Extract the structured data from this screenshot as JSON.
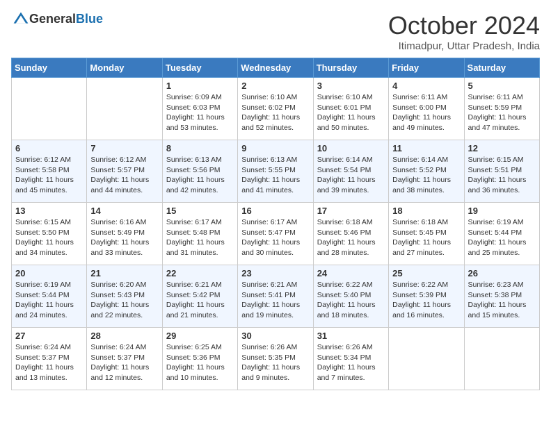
{
  "logo": {
    "general": "General",
    "blue": "Blue"
  },
  "title": "October 2024",
  "location": "Itimadpur, Uttar Pradesh, India",
  "headers": [
    "Sunday",
    "Monday",
    "Tuesday",
    "Wednesday",
    "Thursday",
    "Friday",
    "Saturday"
  ],
  "weeks": [
    [
      {
        "day": null,
        "sunrise": null,
        "sunset": null,
        "daylight": null
      },
      {
        "day": null,
        "sunrise": null,
        "sunset": null,
        "daylight": null
      },
      {
        "day": "1",
        "sunrise": "Sunrise: 6:09 AM",
        "sunset": "Sunset: 6:03 PM",
        "daylight": "Daylight: 11 hours and 53 minutes."
      },
      {
        "day": "2",
        "sunrise": "Sunrise: 6:10 AM",
        "sunset": "Sunset: 6:02 PM",
        "daylight": "Daylight: 11 hours and 52 minutes."
      },
      {
        "day": "3",
        "sunrise": "Sunrise: 6:10 AM",
        "sunset": "Sunset: 6:01 PM",
        "daylight": "Daylight: 11 hours and 50 minutes."
      },
      {
        "day": "4",
        "sunrise": "Sunrise: 6:11 AM",
        "sunset": "Sunset: 6:00 PM",
        "daylight": "Daylight: 11 hours and 49 minutes."
      },
      {
        "day": "5",
        "sunrise": "Sunrise: 6:11 AM",
        "sunset": "Sunset: 5:59 PM",
        "daylight": "Daylight: 11 hours and 47 minutes."
      }
    ],
    [
      {
        "day": "6",
        "sunrise": "Sunrise: 6:12 AM",
        "sunset": "Sunset: 5:58 PM",
        "daylight": "Daylight: 11 hours and 45 minutes."
      },
      {
        "day": "7",
        "sunrise": "Sunrise: 6:12 AM",
        "sunset": "Sunset: 5:57 PM",
        "daylight": "Daylight: 11 hours and 44 minutes."
      },
      {
        "day": "8",
        "sunrise": "Sunrise: 6:13 AM",
        "sunset": "Sunset: 5:56 PM",
        "daylight": "Daylight: 11 hours and 42 minutes."
      },
      {
        "day": "9",
        "sunrise": "Sunrise: 6:13 AM",
        "sunset": "Sunset: 5:55 PM",
        "daylight": "Daylight: 11 hours and 41 minutes."
      },
      {
        "day": "10",
        "sunrise": "Sunrise: 6:14 AM",
        "sunset": "Sunset: 5:54 PM",
        "daylight": "Daylight: 11 hours and 39 minutes."
      },
      {
        "day": "11",
        "sunrise": "Sunrise: 6:14 AM",
        "sunset": "Sunset: 5:52 PM",
        "daylight": "Daylight: 11 hours and 38 minutes."
      },
      {
        "day": "12",
        "sunrise": "Sunrise: 6:15 AM",
        "sunset": "Sunset: 5:51 PM",
        "daylight": "Daylight: 11 hours and 36 minutes."
      }
    ],
    [
      {
        "day": "13",
        "sunrise": "Sunrise: 6:15 AM",
        "sunset": "Sunset: 5:50 PM",
        "daylight": "Daylight: 11 hours and 34 minutes."
      },
      {
        "day": "14",
        "sunrise": "Sunrise: 6:16 AM",
        "sunset": "Sunset: 5:49 PM",
        "daylight": "Daylight: 11 hours and 33 minutes."
      },
      {
        "day": "15",
        "sunrise": "Sunrise: 6:17 AM",
        "sunset": "Sunset: 5:48 PM",
        "daylight": "Daylight: 11 hours and 31 minutes."
      },
      {
        "day": "16",
        "sunrise": "Sunrise: 6:17 AM",
        "sunset": "Sunset: 5:47 PM",
        "daylight": "Daylight: 11 hours and 30 minutes."
      },
      {
        "day": "17",
        "sunrise": "Sunrise: 6:18 AM",
        "sunset": "Sunset: 5:46 PM",
        "daylight": "Daylight: 11 hours and 28 minutes."
      },
      {
        "day": "18",
        "sunrise": "Sunrise: 6:18 AM",
        "sunset": "Sunset: 5:45 PM",
        "daylight": "Daylight: 11 hours and 27 minutes."
      },
      {
        "day": "19",
        "sunrise": "Sunrise: 6:19 AM",
        "sunset": "Sunset: 5:44 PM",
        "daylight": "Daylight: 11 hours and 25 minutes."
      }
    ],
    [
      {
        "day": "20",
        "sunrise": "Sunrise: 6:19 AM",
        "sunset": "Sunset: 5:44 PM",
        "daylight": "Daylight: 11 hours and 24 minutes."
      },
      {
        "day": "21",
        "sunrise": "Sunrise: 6:20 AM",
        "sunset": "Sunset: 5:43 PM",
        "daylight": "Daylight: 11 hours and 22 minutes."
      },
      {
        "day": "22",
        "sunrise": "Sunrise: 6:21 AM",
        "sunset": "Sunset: 5:42 PM",
        "daylight": "Daylight: 11 hours and 21 minutes."
      },
      {
        "day": "23",
        "sunrise": "Sunrise: 6:21 AM",
        "sunset": "Sunset: 5:41 PM",
        "daylight": "Daylight: 11 hours and 19 minutes."
      },
      {
        "day": "24",
        "sunrise": "Sunrise: 6:22 AM",
        "sunset": "Sunset: 5:40 PM",
        "daylight": "Daylight: 11 hours and 18 minutes."
      },
      {
        "day": "25",
        "sunrise": "Sunrise: 6:22 AM",
        "sunset": "Sunset: 5:39 PM",
        "daylight": "Daylight: 11 hours and 16 minutes."
      },
      {
        "day": "26",
        "sunrise": "Sunrise: 6:23 AM",
        "sunset": "Sunset: 5:38 PM",
        "daylight": "Daylight: 11 hours and 15 minutes."
      }
    ],
    [
      {
        "day": "27",
        "sunrise": "Sunrise: 6:24 AM",
        "sunset": "Sunset: 5:37 PM",
        "daylight": "Daylight: 11 hours and 13 minutes."
      },
      {
        "day": "28",
        "sunrise": "Sunrise: 6:24 AM",
        "sunset": "Sunset: 5:37 PM",
        "daylight": "Daylight: 11 hours and 12 minutes."
      },
      {
        "day": "29",
        "sunrise": "Sunrise: 6:25 AM",
        "sunset": "Sunset: 5:36 PM",
        "daylight": "Daylight: 11 hours and 10 minutes."
      },
      {
        "day": "30",
        "sunrise": "Sunrise: 6:26 AM",
        "sunset": "Sunset: 5:35 PM",
        "daylight": "Daylight: 11 hours and 9 minutes."
      },
      {
        "day": "31",
        "sunrise": "Sunrise: 6:26 AM",
        "sunset": "Sunset: 5:34 PM",
        "daylight": "Daylight: 11 hours and 7 minutes."
      },
      {
        "day": null,
        "sunrise": null,
        "sunset": null,
        "daylight": null
      },
      {
        "day": null,
        "sunrise": null,
        "sunset": null,
        "daylight": null
      }
    ]
  ]
}
